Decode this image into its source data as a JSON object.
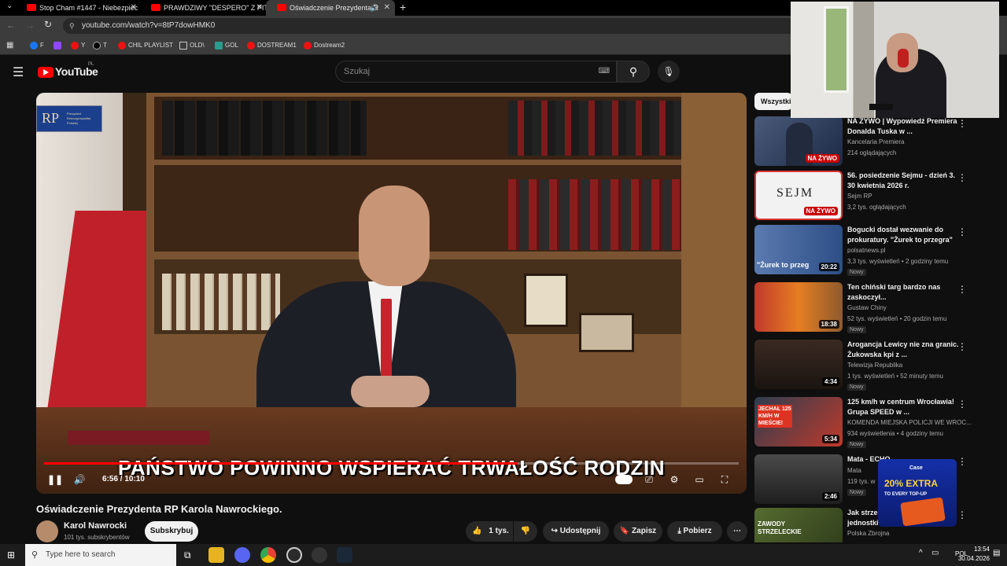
{
  "browser": {
    "tabs": [
      {
        "label": "Stop Cham #1447 - Niebezpiec",
        "active": false
      },
      {
        "label": "PRAWDZIWY \"DESPERO\" Z PITE",
        "active": false
      },
      {
        "label": "Oświadczenie Prezydenta R",
        "active": true
      }
    ],
    "url": "youtube.com/watch?v=8tP7dowHMK0",
    "bookmarks": [
      "F",
      "Y",
      "T",
      "CHIL PLAYLIST",
      "OLD\\",
      "GOL",
      "DOSTREAM1",
      "Dostream2"
    ]
  },
  "youtube": {
    "logo": "YouTube",
    "region": "PL",
    "search_placeholder": "Szukaj"
  },
  "video": {
    "caption": "PAŃSTWO POWINNO WSPIERAĆ TRWAŁOŚĆ RODZIN",
    "time": "6:56 / 10:10",
    "progress": 0.682,
    "seal_text": "RP",
    "seal_sub": "Prezydent Rzeczypospolitej Polskiej",
    "title": "Oświadczenie Prezydenta RP Karola Nawrockiego.",
    "channel": "Karol Nawrocki",
    "subscribers": "101 tys. subskrybentów",
    "subscribe_label": "Subskrybuj",
    "likes": "1 tys.",
    "share_label": "Udostępnij",
    "save_label": "Zapisz",
    "download_label": "Pobierz"
  },
  "sidebar": {
    "chip": "Wszystki",
    "items": [
      {
        "title": "NA ŻYWO | Wypowiedź Premiera Donalda Tuska w ...",
        "channel": "Kancelaria Premiera",
        "meta": "214 oglądających",
        "badge": "NA ŻYWO",
        "new": ""
      },
      {
        "title": "56. posiedzenie Sejmu - dzień 3. 30 kwietnia 2026 r.",
        "channel": "Sejm RP",
        "meta": "3,2 tys. oglądających",
        "badge": "NA ŻYWO",
        "new": ""
      },
      {
        "title": "Bogucki dostał wezwanie do prokuratury. \"Żurek to przegra\"",
        "channel": "polsatnews.pl",
        "meta": "3,3 tys. wyświetleń • 2 godziny temu",
        "badge": "20:22",
        "new": "Nowy"
      },
      {
        "title": "Ten chiński targ bardzo nas zaskoczył...",
        "channel": "Gustaw Chiny",
        "meta": "52 tys. wyświetleń • 20 godzin temu",
        "badge": "18:38",
        "new": "Nowy"
      },
      {
        "title": "Arogancja Lewicy nie zna granic. Żukowska kpi z ...",
        "channel": "Telewizja Republika",
        "meta": "1 tys. wyświetleń • 52 minuty temu",
        "badge": "4:34",
        "new": "Nowy"
      },
      {
        "title": "125 km/h w centrum Wrocławia! Grupa SPEED w ...",
        "channel": "KOMENDA MIEJSKA POLICJI WE WROC...",
        "meta": "934 wyświetlenia • 4 godziny temu",
        "badge": "5:34",
        "new": "Nowy"
      },
      {
        "title": "Mata - ECHO",
        "channel": "Mata",
        "meta": "119 tys. w",
        "badge": "2:46",
        "new": "Nowy"
      },
      {
        "title": "Jak strze jednostki",
        "channel": "Polska Zbrojna",
        "meta": "",
        "badge": "",
        "new": ""
      }
    ],
    "thumb_texts": {
      "sejm": "SEJM",
      "zurek": "\"Żurek to przeg",
      "speed": "JECHAŁ 125 KM/H W MIEŚCIE!",
      "zawody": "ZAWODY STRZELECKIE"
    }
  },
  "ad": {
    "brand": "Case",
    "headline": "20% EXTRA",
    "sub": "TO EVERY TOP-UP"
  },
  "taskbar": {
    "search_placeholder": "Type here to search",
    "lang": "POL",
    "time": "13:54",
    "date": "30.04.2026"
  },
  "colors": {
    "accent": "#ff0000",
    "bg": "#0f0f0f",
    "live": "#cc0000"
  }
}
